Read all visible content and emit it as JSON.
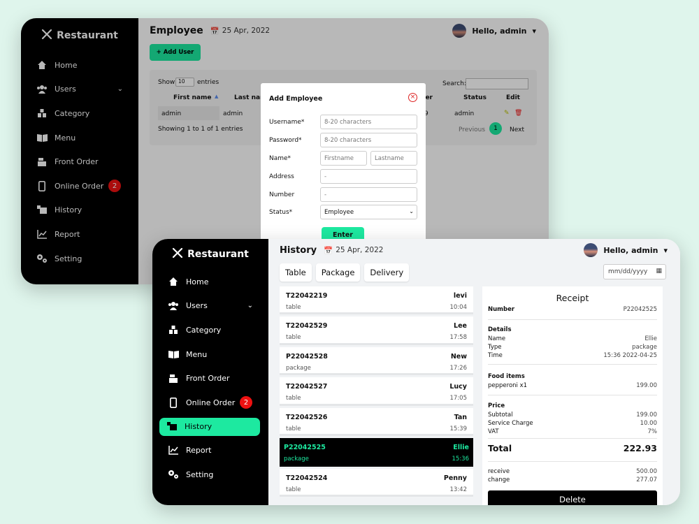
{
  "brand": "Restaurant",
  "user": "Hello, admin",
  "nav": [
    "Home",
    "Users",
    "Category",
    "Menu",
    "Front Order",
    "Online Order",
    "History",
    "Report",
    "Setting"
  ],
  "online_order_badge": "2",
  "win1": {
    "page_title": "Employee",
    "date": "25 Apr, 2022",
    "add_user": "+ Add User",
    "show": "Show",
    "page_size": "10",
    "entries": "entries",
    "search_label": "Search:",
    "columns": [
      "First name",
      "Last nam",
      "ber",
      "Status",
      "Edit"
    ],
    "row": {
      "first": "admin",
      "last": "admin",
      "number": "9",
      "status": "admin"
    },
    "showing": "Showing 1 to 1 of 1 entries",
    "previous": "Previous",
    "page": "1",
    "next": "Next",
    "modal": {
      "title": "Add Employee",
      "username_label": "Username*",
      "username_ph": "8-20 characters",
      "password_label": "Password*",
      "password_ph": "8-20 characters",
      "name_label": "Name*",
      "first_ph": "Firstname",
      "last_ph": "Lastname",
      "address_label": "Address",
      "address_ph": "-",
      "number_label": "Number",
      "number_ph": "-",
      "status_label": "Status*",
      "status_value": "Employee",
      "enter": "Enter"
    }
  },
  "win2": {
    "page_title": "History",
    "date": "25 Apr, 2022",
    "tabs": [
      "Table",
      "Package",
      "Delivery"
    ],
    "date_placeholder": "mm/dd/yyyy",
    "orders": [
      {
        "id": "T22042219",
        "name": "levi",
        "type": "table",
        "time": "10:04"
      },
      {
        "id": "T22042529",
        "name": "Lee",
        "type": "table",
        "time": "17:58"
      },
      {
        "id": "P22042528",
        "name": "New",
        "type": "package",
        "time": "17:26"
      },
      {
        "id": "T22042527",
        "name": "Lucy",
        "type": "table",
        "time": "17:05"
      },
      {
        "id": "T22042526",
        "name": "Tan",
        "type": "table",
        "time": "15:39"
      },
      {
        "id": "P22042525",
        "name": "Ellie",
        "type": "package",
        "time": "15:36"
      },
      {
        "id": "T22042524",
        "name": "Penny",
        "type": "table",
        "time": "13:42"
      }
    ],
    "receipt": {
      "title": "Receipt",
      "number_label": "Number",
      "number": "P22042525",
      "details": "Details",
      "name_label": "Name",
      "name": "Ellie",
      "type_label": "Type",
      "type": "package",
      "time_label": "Time",
      "time": "15:36 2022-04-25",
      "food_items": "Food items",
      "item": "pepperoni x1",
      "item_price": "199.00",
      "price": "Price",
      "subtotal_label": "Subtotal",
      "subtotal": "199.00",
      "service_label": "Service Charge",
      "service": "10.00",
      "vat_label": "VAT",
      "vat": "7%",
      "total_label": "Total",
      "total": "222.93",
      "receive_label": "receive",
      "receive": "500.00",
      "change_label": "change",
      "change": "277.07",
      "delete": "Delete"
    }
  },
  "colors": {
    "accent": "#1de9a0",
    "sidebar": "#000000",
    "badge": "#e11111"
  }
}
